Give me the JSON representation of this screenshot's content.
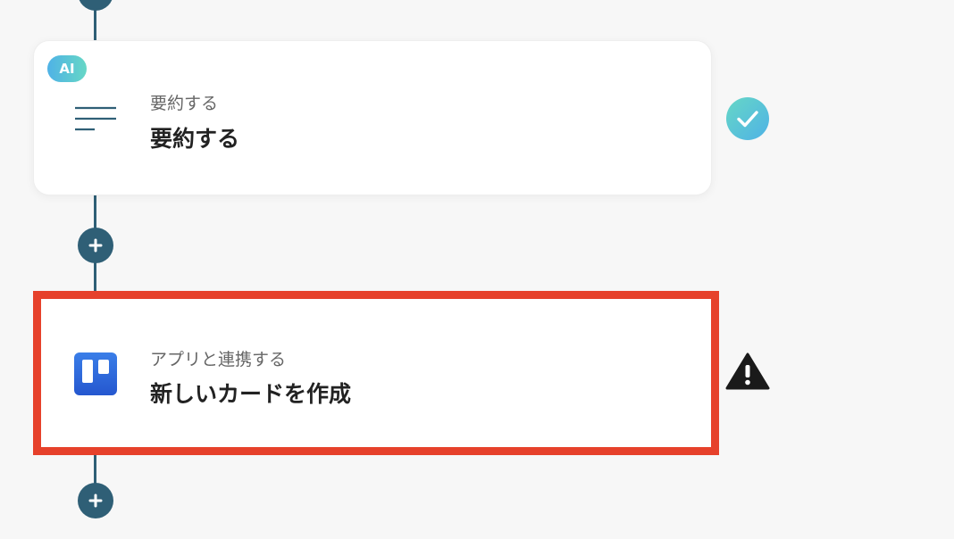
{
  "steps": [
    {
      "badge": "AI",
      "subtitle": "要約する",
      "title": "要約する",
      "icon": "summary-lines-icon",
      "status": "check-icon"
    },
    {
      "subtitle": "アプリと連携する",
      "title": "新しいカードを作成",
      "icon": "trello-icon",
      "status": "warning-icon"
    }
  ],
  "colors": {
    "connector": "#2f5f76",
    "highlight": "#e6412b",
    "ai_badge_start": "#4fb2e6",
    "ai_badge_end": "#66d7c6",
    "trello": "#2f6fe0",
    "warning": "#1a1a1a",
    "background": "#f7f7f7"
  }
}
